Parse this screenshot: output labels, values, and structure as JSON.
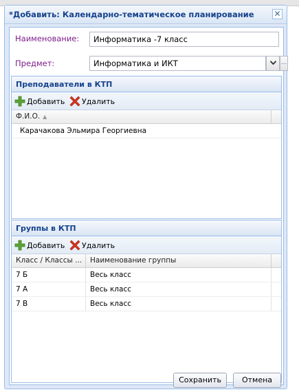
{
  "dialog": {
    "title": "*Добавить: Календарно-тематическое планирование",
    "close_glyph": "✕"
  },
  "form": {
    "name_label": "Наименование:",
    "name_value": "Информатика -7 класс",
    "subject_label": "Предмет:",
    "subject_value": "Информатика и ИКТ",
    "subject_dots": "..."
  },
  "teachers_panel": {
    "title": "Преподаватели в КТП",
    "add_label": "Добавить",
    "delete_label": "Удалить",
    "columns": [
      "Ф.И.О."
    ],
    "rows": [
      {
        "fio": "Карачакова Эльмира Георгиевна"
      }
    ]
  },
  "groups_panel": {
    "title": "Группы в КТП",
    "add_label": "Добавить",
    "delete_label": "Удалить",
    "columns": [
      "Класс / Классы ...",
      "Наименование группы"
    ],
    "rows": [
      {
        "class": "7 Б",
        "group": "Весь класс"
      },
      {
        "class": "7 А",
        "group": "Весь класс"
      },
      {
        "class": "7 В",
        "group": "Весь класс"
      }
    ]
  },
  "footer": {
    "save_label": "Сохранить",
    "cancel_label": "Отмена"
  },
  "colors": {
    "label": "#7d1d8a",
    "title": "#15428b",
    "border": "#99bbe8",
    "add_icon": "#5ba633",
    "delete_icon": "#d9341f"
  }
}
